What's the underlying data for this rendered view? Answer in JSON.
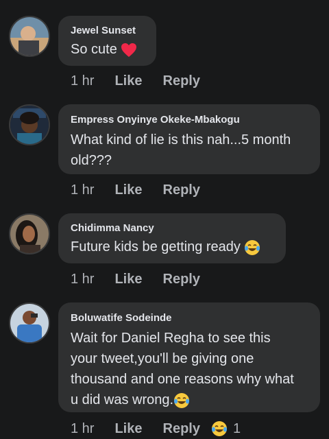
{
  "comments": [
    {
      "author": "Jewel Sunset",
      "text": "So cute",
      "emoji": "red-heart-icon",
      "time": "1 hr",
      "like_label": "Like",
      "reply_label": "Reply"
    },
    {
      "author": "Empress Onyinye Okeke-Mbakogu",
      "text_line1": "What kind of lie is this nah...5 month",
      "text_line2": "old???",
      "time": "1 hr",
      "like_label": "Like",
      "reply_label": "Reply"
    },
    {
      "author": "Chidimma Nancy",
      "text": "Future kids be getting ready",
      "emoji": "tears-of-joy-icon",
      "time": "1 hr",
      "like_label": "Like",
      "reply_label": "Reply"
    },
    {
      "author": "Boluwatife Sodeinde",
      "text_line1": "Wait for Daniel Regha to see this",
      "text_line2": "your tweet,you'll be giving one",
      "text_line3": "thousand and one reasons why what",
      "text_line4": "u did was wrong.",
      "emoji": "tears-of-joy-icon",
      "time": "1 hr",
      "like_label": "Like",
      "reply_label": "Reply",
      "reaction_count": "1"
    }
  ],
  "colors": {
    "background": "#18191a",
    "bubble": "#2f3031",
    "primary_text": "#e4e6eb",
    "secondary_text": "#b0b3b8",
    "heart": "#f02849",
    "emoji_face": "#f7c93e"
  }
}
